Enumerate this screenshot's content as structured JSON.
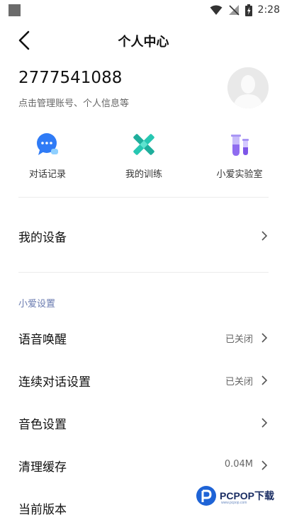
{
  "status_bar": {
    "time": "2:28"
  },
  "header": {
    "title": "个人中心"
  },
  "profile": {
    "user_id": "2777541088",
    "subtitle": "点击管理账号、个人信息等"
  },
  "features": [
    {
      "label": "对话记录",
      "icon": "chat-icon"
    },
    {
      "label": "我的训练",
      "icon": "training-icon"
    },
    {
      "label": "小爱实验室",
      "icon": "lab-icon"
    }
  ],
  "devices": {
    "label": "我的设备"
  },
  "settings": {
    "section_title": "小爱设置",
    "items": [
      {
        "label": "语音唤醒",
        "value": "已关闭"
      },
      {
        "label": "连续对话设置",
        "value": "已关闭"
      },
      {
        "label": "音色设置",
        "value": ""
      },
      {
        "label": "清理缓存",
        "value": "0.04M"
      },
      {
        "label": "当前版本",
        "value": ""
      }
    ]
  },
  "watermark": {
    "text": "PCPOP下载",
    "sub": "www.pcpop.com"
  },
  "colors": {
    "chat": "#2f7bf6",
    "training": "#27c7b2",
    "lab": "#8f6cf0"
  }
}
